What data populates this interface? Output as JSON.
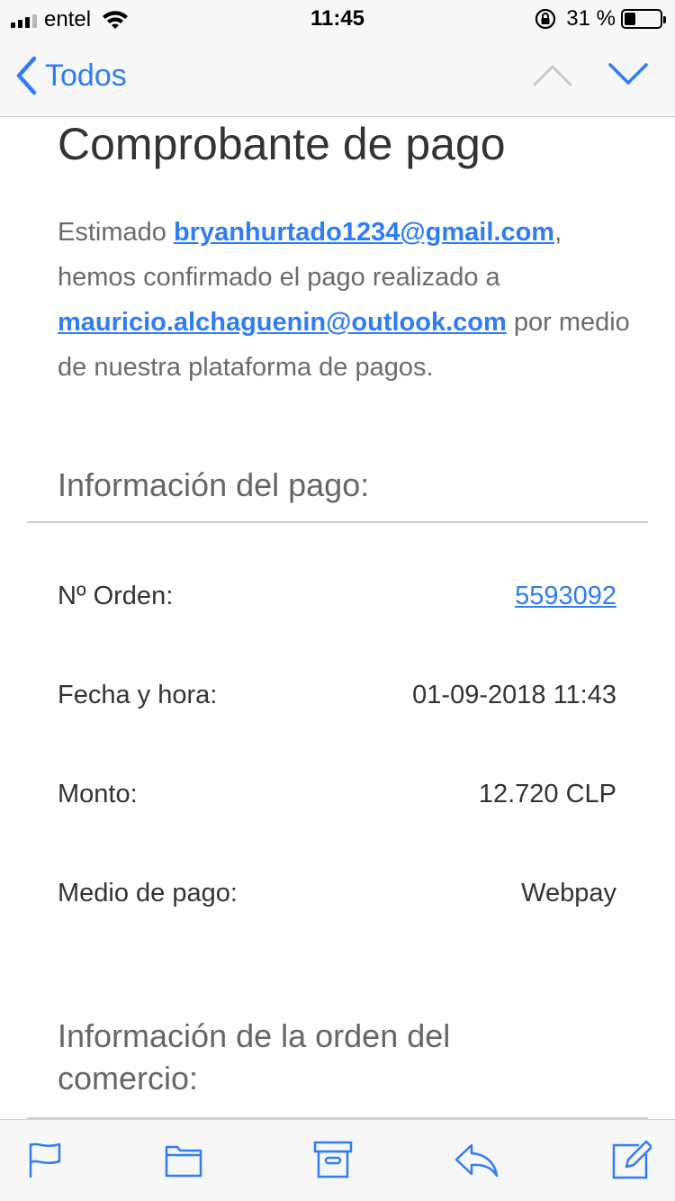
{
  "status_bar": {
    "carrier": "entel",
    "time": "11:45",
    "battery_percent": "31 %",
    "battery_level": 0.31
  },
  "nav": {
    "back_label": "Todos"
  },
  "email": {
    "title": "Comprobante de pago",
    "intro_prefix": "Estimado ",
    "sender_email": "bryanhurtado1234@gmail.com",
    "intro_middle": ", hemos confirmado el pago realizado a ",
    "recipient_email": "mauricio.alchaguenin@outlook.com",
    "intro_suffix": " por medio de nuestra plataforma de pagos.",
    "payment_section_title": "Información del pago:",
    "payment_info": [
      {
        "label": "Nº Orden:",
        "value": "5593092"
      },
      {
        "label": "Fecha y hora:",
        "value": "01-09-2018 11:43"
      },
      {
        "label": "Monto:",
        "value": "12.720 CLP"
      },
      {
        "label": "Medio de pago:",
        "value": "Webpay"
      }
    ],
    "order_section_title": "Información de la orden del comercio:"
  },
  "colors": {
    "accent": "#2f7cf6",
    "bar_background": "#f7f7f7"
  },
  "toolbar_icons": [
    "flag-icon",
    "folder-icon",
    "archive-icon",
    "reply-icon",
    "compose-icon"
  ]
}
